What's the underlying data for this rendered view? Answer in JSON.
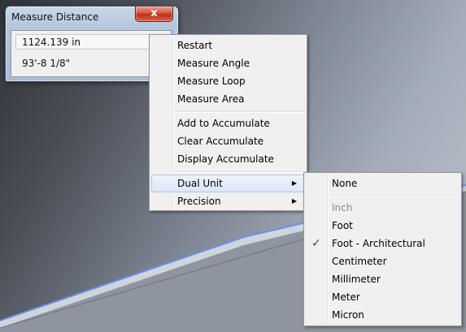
{
  "measure_window": {
    "title": "Measure Distance",
    "close_label": "x",
    "value": "1124.139 in",
    "architectural_value": "93'-8 1/8\""
  },
  "context_menu": {
    "items": [
      {
        "label": "Restart"
      },
      {
        "label": "Measure Angle"
      },
      {
        "label": "Measure Loop"
      },
      {
        "label": "Measure Area"
      },
      {
        "label": "Add to Accumulate"
      },
      {
        "label": "Clear Accumulate"
      },
      {
        "label": "Display Accumulate"
      },
      {
        "label": "Dual Unit",
        "submenu": true,
        "highlighted": true
      },
      {
        "label": "Precision",
        "submenu": true
      }
    ],
    "submenu_arrow": "▶"
  },
  "dual_unit_submenu": {
    "items": [
      {
        "label": "None"
      },
      {
        "label": "Inch",
        "disabled": true
      },
      {
        "label": "Foot"
      },
      {
        "label": "Foot - Architectural",
        "checked": true
      },
      {
        "label": "Centimeter"
      },
      {
        "label": "Millimeter"
      },
      {
        "label": "Meter"
      },
      {
        "label": "Micron"
      }
    ],
    "check_glyph": "✓"
  },
  "colors": {
    "menu_background": "#f0f0f0",
    "highlight_border": "#a8c6ea",
    "beam_edge": "#6f8fe8",
    "disabled_text": "#8d8d8d"
  }
}
